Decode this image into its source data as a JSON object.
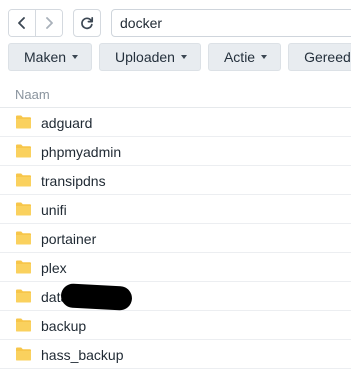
{
  "address": {
    "path": "docker"
  },
  "toolbar": {
    "buttons": [
      {
        "label": "Maken",
        "icon": "caret-down-icon"
      },
      {
        "label": "Uploaden",
        "icon": "caret-down-icon"
      },
      {
        "label": "Actie",
        "icon": "caret-down-icon"
      },
      {
        "label": "Gereedschap",
        "icon": "caret-down-icon"
      }
    ]
  },
  "list": {
    "column_name": "Naam",
    "items": [
      {
        "name": "adguard",
        "icon": "folder-icon"
      },
      {
        "name": "phpmyadmin",
        "icon": "folder-icon"
      },
      {
        "name": "transipdns",
        "icon": "folder-icon"
      },
      {
        "name": "unifi",
        "icon": "folder-icon"
      },
      {
        "name": "portainer",
        "icon": "folder-icon"
      },
      {
        "name": "plex",
        "icon": "folder-icon"
      },
      {
        "name": "data",
        "icon": "folder-icon"
      },
      {
        "name": "backup",
        "icon": "folder-icon"
      },
      {
        "name": "hass_backup",
        "icon": "folder-icon"
      }
    ]
  },
  "colors": {
    "folder": "#f7c64a",
    "toolbar_bg": "#e8ecf0",
    "border": "#d4d9df",
    "text": "#1f2933",
    "muted": "#8a949e"
  }
}
